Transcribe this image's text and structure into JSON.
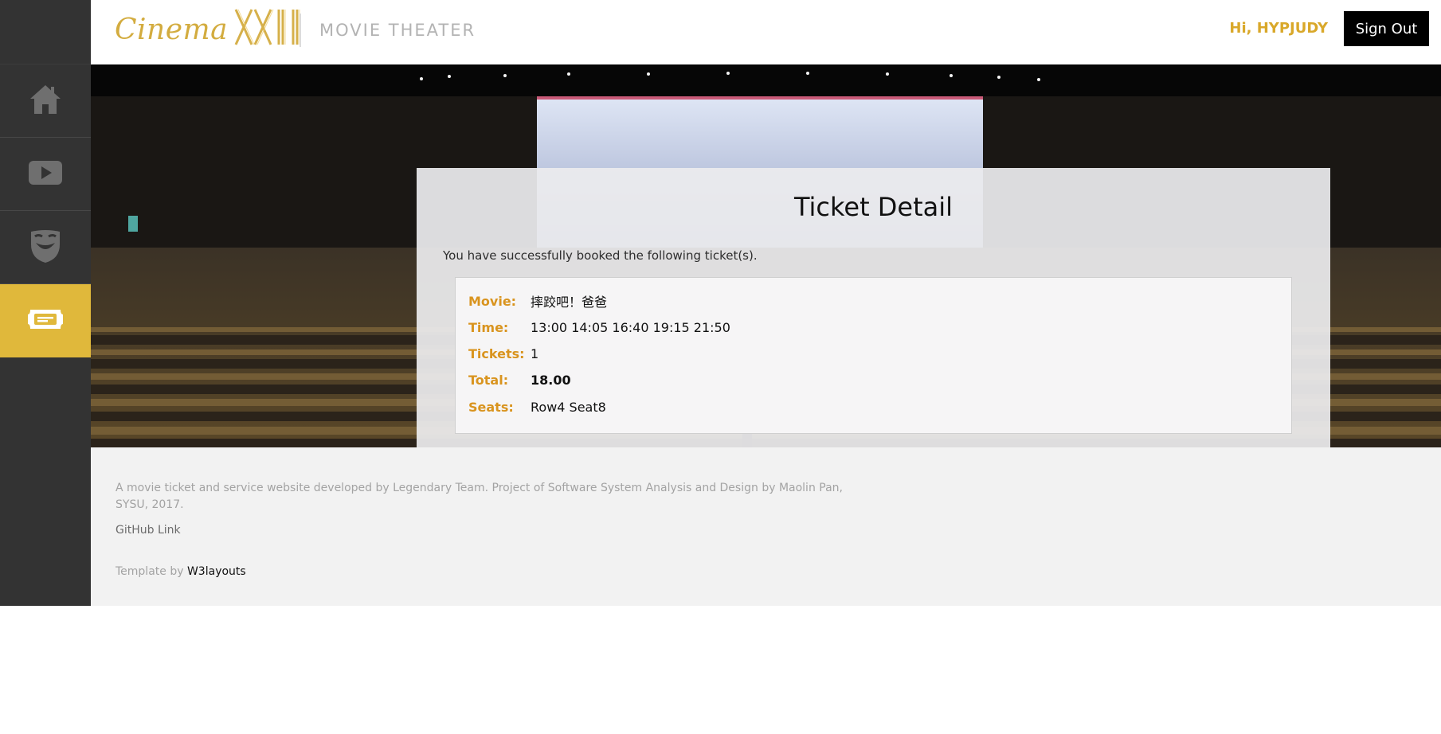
{
  "brand": {
    "logo_text": "Cinema",
    "logo_numeral": "XXII",
    "tagline": "MOVIE THEATER",
    "accent_color": "#e0b83b"
  },
  "header": {
    "greeting": "Hi, HYPJUDY",
    "signout_label": "Sign Out"
  },
  "sidebar": {
    "items": [
      {
        "icon": "home-icon",
        "active": false
      },
      {
        "icon": "play-icon",
        "active": false
      },
      {
        "icon": "mask-icon",
        "active": false
      },
      {
        "icon": "ticket-icon",
        "active": true
      }
    ]
  },
  "ticket": {
    "title": "Ticket Detail",
    "success_message": "You have successfully booked the following ticket(s).",
    "rows": [
      {
        "label": "Movie:",
        "value": "摔跤吧！爸爸"
      },
      {
        "label": "Time:",
        "value": "13:00 14:05 16:40 19:15 21:50"
      },
      {
        "label": "Tickets:",
        "value": "1"
      },
      {
        "label": "Total:",
        "value": "18.00"
      },
      {
        "label": "Seats:",
        "value": "Row4 Seat8"
      }
    ]
  },
  "footer": {
    "about": "A movie ticket and service website developed by Legendary Team. Project of Software System Analysis and Design by Maolin Pan, SYSU, 2017.",
    "github_link": "GitHub Link",
    "template_prefix": "Template by",
    "template_link": "W3layouts"
  }
}
